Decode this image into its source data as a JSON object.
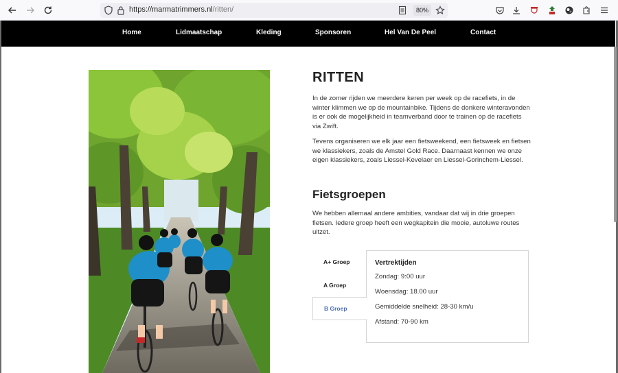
{
  "browser": {
    "url_domain": "https://marmatrimmers.nl",
    "url_path": "/ritten/",
    "zoom": "80%"
  },
  "nav": {
    "items": [
      {
        "label": "Home",
        "name": "nav-home"
      },
      {
        "label": "Lidmaatschap",
        "name": "nav-lidmaatschap"
      },
      {
        "label": "Kleding",
        "name": "nav-kleding"
      },
      {
        "label": "Sponsoren",
        "name": "nav-sponsoren"
      },
      {
        "label": "Hel Van De Peel",
        "name": "nav-hel-van-de-peel"
      },
      {
        "label": "Contact",
        "name": "nav-contact"
      }
    ]
  },
  "main": {
    "title": "RITTEN",
    "intro_1": "In de zomer rijden we meerdere keren per week op de racefiets, in de winter klimmen we op de mountainbike. Tijdens de donkere winteravonden is er ook de mogelijkheid in teamverband door te trainen op de racefiets via Zwift.",
    "intro_2": "Tevens organiseren we elk jaar een fietsweekend, een fietsweek en fietsen we klassiekers, zoals de Amstel Gold Race. Daarnaast kennen we onze eigen klassiekers, zoals Liessel-Kevelaer en Liessel-Gorinchem-Liessel.",
    "section_title": "Fietsgroepen",
    "section_text": "We hebben allemaal andere ambities, vandaar dat wij in drie groepen fietsen. Iedere groep heeft een wegkapitein die mooie, autoluwe routes uitzet."
  },
  "tabs": [
    {
      "label": "A+ Groep"
    },
    {
      "label": "A Groep"
    },
    {
      "label": "B Groep"
    }
  ],
  "active_tab": "B Groep",
  "panel": {
    "title": "Vertrektijden",
    "lines": [
      "Zondag: 9:00 uur",
      "Woensdag: 18.00 uur",
      "Gemiddelde snelheid: 28-30 km/u",
      "Afstand: 70-90 km"
    ]
  },
  "colors": {
    "nav_bg": "#000000",
    "active_tab": "#4a6fbf"
  }
}
